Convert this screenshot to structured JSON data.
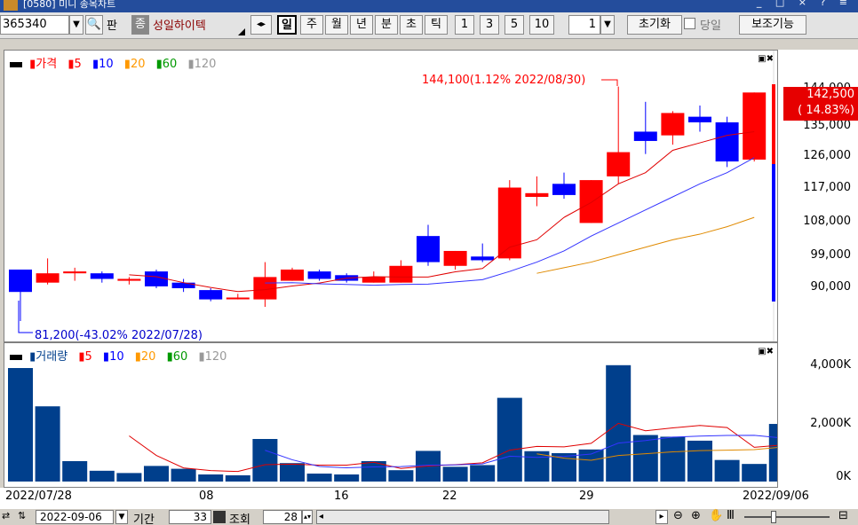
{
  "window": {
    "title": "[0580] 미니 종목차트",
    "controls": "_ □ × ? ≡"
  },
  "toolbar": {
    "code": "365340",
    "trade_label": "판",
    "type_label": "종",
    "stock_name": "성일하이텍",
    "periods": [
      "일",
      "주",
      "월",
      "년",
      "분",
      "초",
      "틱"
    ],
    "selected_period": "일",
    "intervals": [
      "1",
      "3",
      "5",
      "10"
    ],
    "unit_value": "1",
    "reset_label": "초기화",
    "sameday_label": "당일",
    "aux_label": "보조기능"
  },
  "price_panel": {
    "legend": [
      {
        "label": "가격",
        "color": "#ff0000"
      },
      {
        "label": "5",
        "color": "#ff0000"
      },
      {
        "label": "10",
        "color": "#0000ff"
      },
      {
        "label": "20",
        "color": "#ff9900"
      },
      {
        "label": "60",
        "color": "#009900"
      },
      {
        "label": "120",
        "color": "#999999"
      }
    ],
    "max_annotation": "144,100(1.12% 2022/08/30)",
    "min_annotation": "81,200(-43.02% 2022/07/28)",
    "current_price": "142,500",
    "current_change": "( 14.83%)",
    "yticks": [
      "144,000",
      "135,000",
      "126,000",
      "117,000",
      "108,000",
      "99,000",
      "90,000"
    ]
  },
  "volume_panel": {
    "legend": [
      {
        "label": "거래량",
        "color": "#003f8c"
      },
      {
        "label": "5",
        "color": "#ff0000"
      },
      {
        "label": "10",
        "color": "#0000ff"
      },
      {
        "label": "20",
        "color": "#ff9900"
      },
      {
        "label": "60",
        "color": "#009900"
      },
      {
        "label": "120",
        "color": "#999999"
      }
    ],
    "yticks": [
      "4,000K",
      "2,000K",
      "0K"
    ]
  },
  "xaxis": {
    "labels": [
      "2022/07/28",
      "08",
      "16",
      "22",
      "29",
      "2022/09/06"
    ]
  },
  "bottombar": {
    "date": "2022-09-06",
    "period_label": "기간",
    "period_value": "33",
    "query_label": "조회",
    "query_value": "28"
  },
  "chart_data": {
    "type": "candlestick",
    "candles": [
      {
        "o": 89000,
        "h": 95000,
        "l": 81200,
        "c": 95000,
        "up": false
      },
      {
        "o": 91500,
        "h": 98000,
        "l": 91000,
        "c": 94000,
        "up": true
      },
      {
        "o": 94000,
        "h": 95500,
        "l": 92000,
        "c": 94500,
        "up": true
      },
      {
        "o": 94000,
        "h": 94500,
        "l": 91500,
        "c": 92500,
        "up": false
      },
      {
        "o": 92000,
        "h": 93000,
        "l": 91000,
        "c": 92500,
        "up": true
      },
      {
        "o": 94500,
        "h": 95000,
        "l": 90000,
        "c": 90500,
        "up": false
      },
      {
        "o": 91500,
        "h": 92500,
        "l": 89000,
        "c": 90000,
        "up": false
      },
      {
        "o": 89500,
        "h": 90000,
        "l": 86500,
        "c": 87000,
        "up": false
      },
      {
        "o": 87500,
        "h": 88500,
        "l": 87000,
        "c": 87500,
        "up": true
      },
      {
        "o": 87000,
        "h": 97000,
        "l": 85000,
        "c": 93000,
        "up": true
      },
      {
        "o": 92000,
        "h": 95500,
        "l": 92000,
        "c": 95000,
        "up": true
      },
      {
        "o": 94500,
        "h": 95000,
        "l": 92000,
        "c": 92500,
        "up": false
      },
      {
        "o": 93500,
        "h": 94000,
        "l": 91500,
        "c": 92000,
        "up": false
      },
      {
        "o": 91500,
        "h": 94500,
        "l": 91500,
        "c": 93000,
        "up": true
      },
      {
        "o": 91500,
        "h": 97500,
        "l": 91500,
        "c": 96000,
        "up": true
      },
      {
        "o": 104000,
        "h": 107000,
        "l": 96000,
        "c": 97000,
        "up": false
      },
      {
        "o": 96000,
        "h": 100000,
        "l": 95000,
        "c": 100000,
        "up": true
      },
      {
        "o": 98500,
        "h": 102000,
        "l": 97000,
        "c": 97500,
        "up": false
      },
      {
        "o": 98000,
        "h": 119000,
        "l": 97500,
        "c": 117000,
        "up": true
      },
      {
        "o": 114500,
        "h": 120000,
        "l": 112000,
        "c": 115500,
        "up": true
      },
      {
        "o": 115000,
        "h": 121000,
        "l": 114000,
        "c": 118000,
        "up": false
      },
      {
        "o": 107500,
        "h": 119000,
        "l": 107500,
        "c": 119000,
        "up": true
      },
      {
        "o": 120000,
        "h": 144100,
        "l": 118000,
        "c": 126500,
        "up": true
      },
      {
        "o": 129500,
        "h": 140000,
        "l": 126000,
        "c": 132000,
        "up": false
      },
      {
        "o": 131000,
        "h": 137500,
        "l": 128500,
        "c": 137000,
        "up": true
      },
      {
        "o": 136000,
        "h": 139000,
        "l": 132000,
        "c": 134500,
        "up": false
      },
      {
        "o": 134500,
        "h": 136000,
        "l": 122500,
        "c": 124000,
        "up": false
      },
      {
        "o": 124500,
        "h": 142500,
        "l": 124000,
        "c": 142500,
        "up": true
      }
    ],
    "volume": [
      4000,
      2650,
      720,
      380,
      300,
      550,
      450,
      250,
      220,
      1500,
      650,
      280,
      250,
      720,
      400,
      1080,
      520,
      580,
      2950,
      1070,
      1000,
      1130,
      4100,
      1640,
      1580,
      1440,
      760,
      620,
      2030
    ],
    "ma5_price": [
      null,
      null,
      null,
      null,
      93600,
      93100,
      91500,
      90200,
      89100,
      89600,
      90600,
      91400,
      92700,
      93100,
      93000,
      93000,
      94400,
      95300,
      101000,
      103000,
      109000,
      113000,
      118000,
      121000,
      127000,
      129000,
      131000,
      132000
    ],
    "ma10_price": [
      null,
      null,
      null,
      null,
      null,
      null,
      null,
      null,
      null,
      91400,
      91500,
      91200,
      91000,
      90800,
      91000,
      91100,
      91700,
      92300,
      94500,
      97000,
      100000,
      104000,
      107500,
      111000,
      114500,
      118000,
      121000,
      125000
    ],
    "ma20_price": [
      null,
      null,
      null,
      null,
      null,
      null,
      null,
      null,
      null,
      null,
      null,
      null,
      null,
      null,
      null,
      null,
      null,
      null,
      null,
      94000,
      95500,
      97000,
      99000,
      101000,
      103000,
      104500,
      106500,
      109000
    ]
  }
}
